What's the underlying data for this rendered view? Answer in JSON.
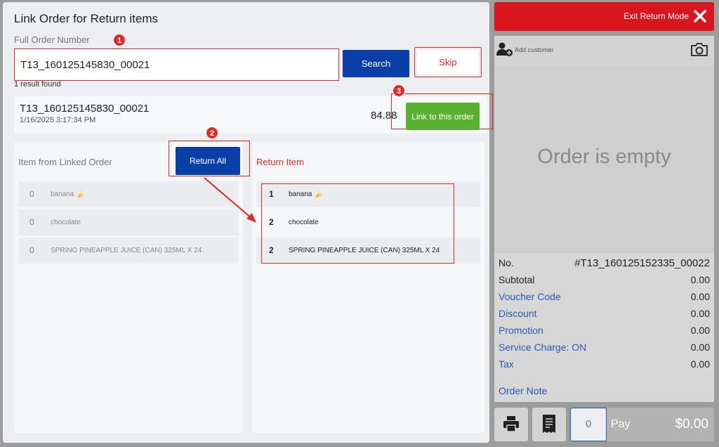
{
  "dialog": {
    "title": "Link Order for Return items",
    "field_label": "Full Order Number",
    "order_number_value": "T13_160125145830_00021",
    "search_label": "Search",
    "skip_label": "Skip",
    "result_count": "1 result found"
  },
  "result": {
    "order_id": "T13_160125145830_00021",
    "date": "1/16/2025 3:17:34 PM",
    "amount": "84.88",
    "link_label": "Link to this order"
  },
  "linked_items": {
    "title": "Item from Linked Order",
    "return_all_label": "Return All",
    "items": [
      {
        "qty": "0",
        "name": "banana 🍌"
      },
      {
        "qty": "0",
        "name": "chocolate"
      },
      {
        "qty": "0",
        "name": "SPRING PINEAPPLE JUICE (CAN) 325ML X 24"
      }
    ]
  },
  "return_items": {
    "title": "Return Item",
    "items": [
      {
        "qty": "1",
        "name": "banana 🍌"
      },
      {
        "qty": "2",
        "name": "chocolate"
      },
      {
        "qty": "2",
        "name": "SPRING PINEAPPLE JUICE (CAN) 325ML X 24"
      }
    ]
  },
  "annotations": {
    "step1": "1",
    "step2": "2",
    "step3": "3"
  },
  "cart": {
    "exit_label": "Exit Return Mode",
    "add_customer_label": "Add customer",
    "empty_label": "Order is empty",
    "summary": [
      {
        "key": "No.",
        "value": "#T13_160125152335_00022"
      },
      {
        "key": "Subtotal",
        "value": "0.00"
      },
      {
        "key": "Voucher Code",
        "value": "0.00"
      },
      {
        "key": "Discount",
        "value": "0.00"
      },
      {
        "key": "Promotion",
        "value": "0.00"
      },
      {
        "key": "Service Charge: ON",
        "value": "0.00"
      },
      {
        "key": "Tax",
        "value": "0.00"
      }
    ],
    "order_note_label": "Order Note",
    "quantity": "0",
    "pay_label": "Pay",
    "pay_amount": "$0.00"
  },
  "colors": {
    "primary_blue": "#0b3fa8",
    "accent_red": "#e02a2a",
    "link_green": "#5ab12f",
    "exit_red": "#d9161e",
    "link_text_blue": "#2a5ab0"
  }
}
